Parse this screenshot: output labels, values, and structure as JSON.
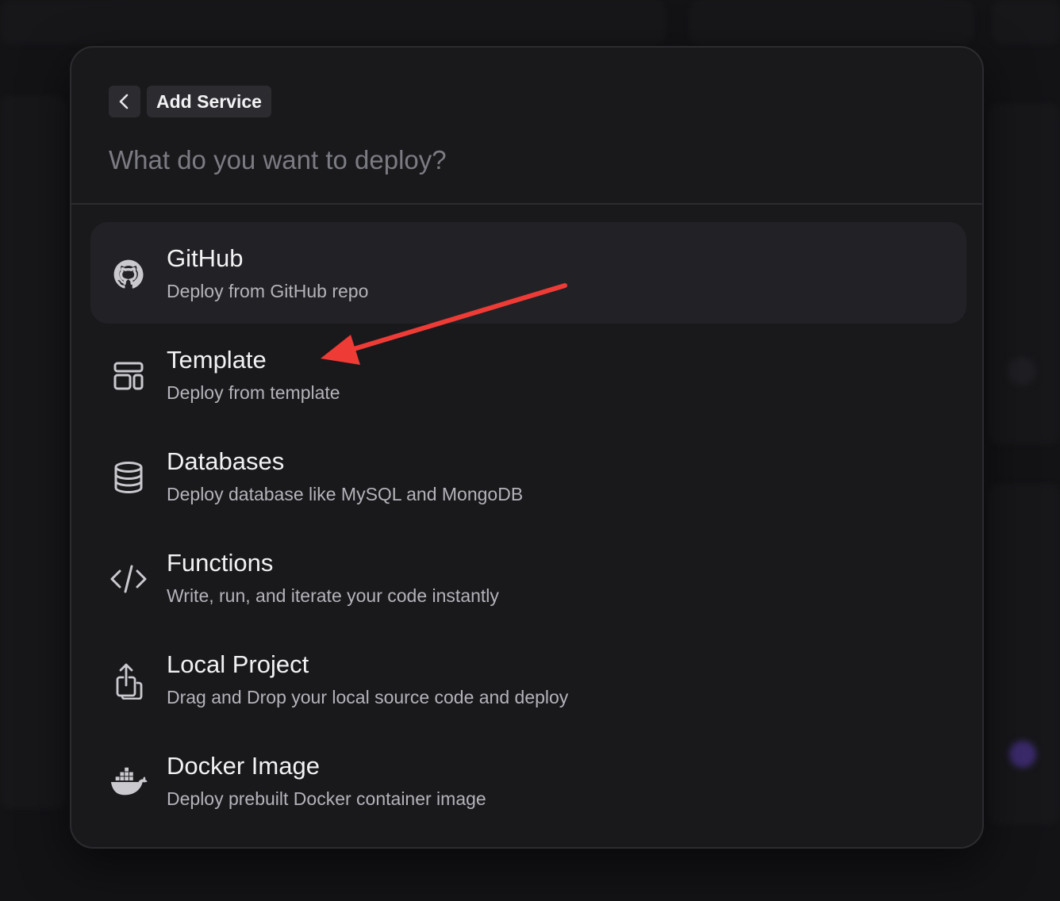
{
  "colors": {
    "background": "#131316",
    "modal": "#19191c",
    "border": "#2c2c30",
    "active_row": "#222226",
    "title_text": "#f2f2f4",
    "desc_text": "#b3b3b9",
    "placeholder_text": "#7b7b82",
    "annotation_arrow": "#ef3b36"
  },
  "dialog": {
    "back_icon": "chevron-left-icon",
    "title": "Add Service",
    "search": {
      "value": "",
      "placeholder": "What do you want to deploy?"
    }
  },
  "options": [
    {
      "icon": "github-icon",
      "title": "GitHub",
      "description": "Deploy from GitHub repo",
      "highlighted": true
    },
    {
      "icon": "template-icon",
      "title": "Template",
      "description": "Deploy from template",
      "highlighted": false
    },
    {
      "icon": "database-icon",
      "title": "Databases",
      "description": "Deploy database like MySQL and MongoDB",
      "highlighted": false
    },
    {
      "icon": "code-icon",
      "title": "Functions",
      "description": "Write, run, and iterate your code instantly",
      "highlighted": false
    },
    {
      "icon": "upload-icon",
      "title": "Local Project",
      "description": "Drag and Drop your local source code and deploy",
      "highlighted": false
    },
    {
      "icon": "docker-icon",
      "title": "Docker Image",
      "description": "Deploy prebuilt Docker container image",
      "highlighted": false
    }
  ],
  "annotation": {
    "type": "arrow",
    "points_to": "Template"
  }
}
